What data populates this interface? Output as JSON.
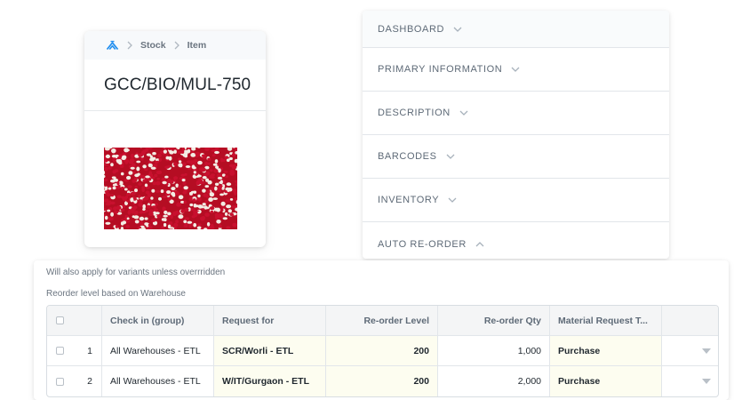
{
  "item_card": {
    "breadcrumb": [
      "Stock",
      "Item"
    ],
    "title": "GCC/BIO/MUL-750"
  },
  "sections": [
    {
      "label": "DASHBOARD",
      "state": "collapsed"
    },
    {
      "label": "PRIMARY INFORMATION",
      "state": "collapsed"
    },
    {
      "label": "DESCRIPTION",
      "state": "collapsed"
    },
    {
      "label": "BARCODES",
      "state": "collapsed"
    },
    {
      "label": "INVENTORY",
      "state": "collapsed"
    },
    {
      "label": "AUTO RE-ORDER",
      "state": "expanded"
    }
  ],
  "reorder": {
    "help_variants": "Will also apply for variants unless overrridden",
    "help_reorder": "Reorder level based on Warehouse",
    "columns": [
      "Check in (group)",
      "Request for",
      "Re-order Level",
      "Re-order Qty",
      "Material Request T..."
    ],
    "rows": [
      {
        "idx": "1",
        "group": "All Warehouses - ETL",
        "request_for": "SCR/Worli - ETL",
        "level": "200",
        "qty": "1,000",
        "type": "Purchase"
      },
      {
        "idx": "2",
        "group": "All Warehouses - ETL",
        "request_for": "W/IT/Gurgaon - ETL",
        "level": "200",
        "qty": "2,000",
        "type": "Purchase"
      }
    ]
  },
  "colors": {
    "accent": "#2490ef",
    "editable_cell_bg": "#fdfdf0",
    "pill_red": "#c8102e",
    "pill_white": "#f3ede4"
  },
  "icons": {
    "home": "erpnext-logo-icon",
    "separator": "chevron-right-icon",
    "collapsed": "chevron-down-icon",
    "expanded": "chevron-up-icon",
    "row_action": "caret-down-icon"
  }
}
